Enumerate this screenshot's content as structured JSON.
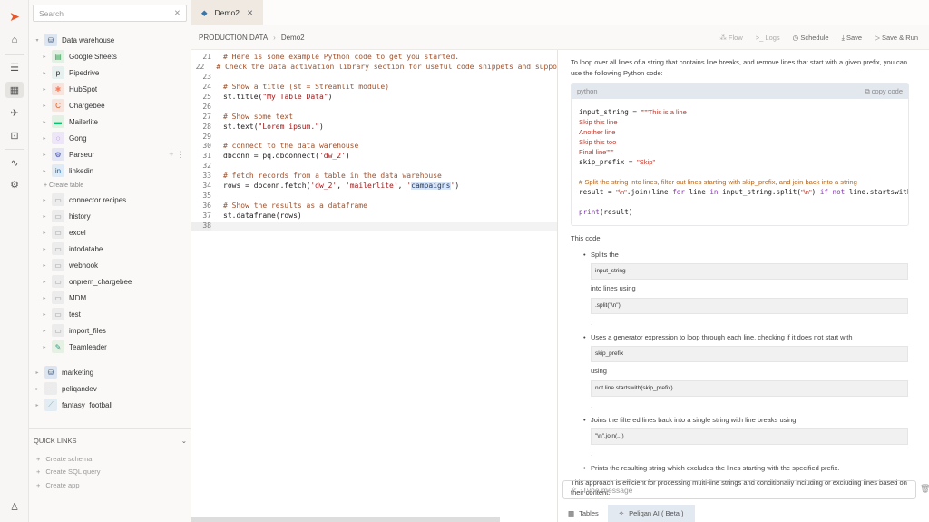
{
  "rail": {
    "icons": [
      "logo-icon",
      "home-icon",
      "stack-icon",
      "table-icon",
      "rocket-icon",
      "box-icon",
      "activity-icon",
      "gear-icon",
      "user-icon"
    ],
    "active": "table-icon"
  },
  "sidebar": {
    "search_placeholder": "Search",
    "root": {
      "label": "Data warehouse",
      "expanded": true
    },
    "items": [
      {
        "label": "Google Sheets",
        "icon": "google-sheets-icon",
        "bg": "#e3f1e5",
        "fg": "#34a853",
        "glyph": "▤"
      },
      {
        "label": "Pipedrive",
        "icon": "pipedrive-icon",
        "bg": "#e6f0ee",
        "fg": "#1a1a1a",
        "glyph": "p"
      },
      {
        "label": "HubSpot",
        "icon": "hubspot-icon",
        "bg": "#f6e5df",
        "fg": "#ff7a59",
        "glyph": "✱"
      },
      {
        "label": "Chargebee",
        "icon": "chargebee-icon",
        "bg": "#f6e5df",
        "fg": "#e0591f",
        "glyph": "C"
      },
      {
        "label": "Mailerlite",
        "icon": "mailerlite-icon",
        "bg": "#e3f1e5",
        "fg": "#09c269",
        "glyph": "▬"
      },
      {
        "label": "Gong",
        "icon": "gong-icon",
        "bg": "#ece6f6",
        "fg": "#8039df",
        "glyph": "◌"
      },
      {
        "label": "Parseur",
        "icon": "parseur-icon",
        "bg": "#e4e6f3",
        "fg": "#3b4cae",
        "glyph": "⚙"
      },
      {
        "label": "linkedin",
        "icon": "linkedin-icon",
        "bg": "#e1ebf5",
        "fg": "#0a66c2",
        "glyph": "in"
      }
    ],
    "create_table": "+ Create table",
    "folders": [
      "connector recipes",
      "history",
      "excel",
      "intodatabe",
      "webhook",
      "onprem_chargebee",
      "MDM",
      "test",
      "import_files"
    ],
    "teamleader": "Teamleader",
    "roots": [
      {
        "label": "marketing",
        "icon": "database-icon"
      },
      {
        "label": "peliqandev",
        "icon": "server-icon"
      },
      {
        "label": "fantasy_football",
        "icon": "chart-icon"
      }
    ],
    "quick_links": {
      "title": "QUICK LINKS",
      "items": [
        "Create schema",
        "Create SQL query",
        "Create app"
      ]
    }
  },
  "tab": {
    "label": "Demo2"
  },
  "breadcrumb": [
    "PRODUCTION DATA",
    "Demo2"
  ],
  "toolbar": {
    "flow": "Flow",
    "logs": "Logs",
    "schedule": "Schedule",
    "save": "Save",
    "save_run": "Save & Run"
  },
  "editor": {
    "lines": [
      {
        "n": "21",
        "seg": [
          [
            "c",
            "# Here is some example Python code to get you started."
          ]
        ]
      },
      {
        "n": "22",
        "seg": [
          [
            "c",
            "# Check the Data activation library section for useful code snippets and suppo"
          ]
        ]
      },
      {
        "n": "23",
        "seg": []
      },
      {
        "n": "24",
        "seg": [
          [
            "c",
            "# Show a title (st = Streamlit module)"
          ]
        ]
      },
      {
        "n": "25",
        "seg": [
          [
            "p",
            "st.title("
          ],
          [
            "s",
            "\"My Table Data\""
          ],
          [
            "p",
            ")"
          ]
        ]
      },
      {
        "n": "26",
        "seg": []
      },
      {
        "n": "27",
        "seg": [
          [
            "c",
            "# Show some text"
          ]
        ]
      },
      {
        "n": "28",
        "seg": [
          [
            "p",
            "st.text("
          ],
          [
            "s",
            "\"Lorem ipsum.\""
          ],
          [
            "p",
            ")"
          ]
        ]
      },
      {
        "n": "29",
        "seg": []
      },
      {
        "n": "30",
        "seg": [
          [
            "c",
            "# connect to the data warehouse"
          ]
        ]
      },
      {
        "n": "31",
        "seg": [
          [
            "p",
            "dbconn = pq.dbconnect("
          ],
          [
            "s",
            "'dw_2'"
          ],
          [
            "p",
            ")"
          ]
        ]
      },
      {
        "n": "32",
        "seg": []
      },
      {
        "n": "33",
        "seg": [
          [
            "c",
            "# fetch records from a table in the data warehouse"
          ]
        ]
      },
      {
        "n": "34",
        "seg": [
          [
            "p",
            "rows = dbconn.fetch("
          ],
          [
            "s",
            "'dw_2'"
          ],
          [
            "p",
            ", "
          ],
          [
            "s",
            "'mailerlite'"
          ],
          [
            "p",
            ", "
          ],
          [
            "s",
            "'"
          ],
          [
            "h",
            "campaigns"
          ],
          [
            "s",
            "'"
          ],
          [
            "p",
            ")"
          ]
        ]
      },
      {
        "n": "35",
        "seg": []
      },
      {
        "n": "36",
        "seg": [
          [
            "c",
            "# Show the results as a dataframe"
          ]
        ]
      },
      {
        "n": "37",
        "seg": [
          [
            "p",
            "st.dataframe(rows)"
          ]
        ]
      },
      {
        "n": "38",
        "seg": [],
        "current": true
      }
    ]
  },
  "ai": {
    "intro": "To loop over all lines of a string that contains line breaks, and remove lines that start with a given prefix, you can use the following Python code:",
    "code_lang": "python",
    "copy": "copy code",
    "code": {
      "l1a": "input_string = ",
      "l1b": "\"\"\"This is a line",
      "l2": "Skip this line",
      "l3": "Another line",
      "l4": "Skip this too",
      "l5": "Final line\"\"\"",
      "l6a": "skip_prefix = ",
      "l6b": "\"Skip\"",
      "comment": "# Split the string into lines, filter out lines starting with skip_prefix, and join back into a string",
      "r1": "result = ",
      "r2": "\"\\n\"",
      "r3": ".join(line ",
      "r4": "for",
      "r5": " line ",
      "r6": "in",
      "r7": " input_string.split(",
      "r8": "\"\\n\"",
      "r9": ") ",
      "r10": "if not",
      "r11": " line.startswith",
      "p1": "print",
      "p2": "(result)"
    },
    "this_code": "This code:",
    "b1": "Splits the",
    "b1c1": "input_string",
    "b1t": "into lines using",
    "b1c2": ".split(\"\\n\")",
    "b2": "Uses a generator expression to loop through each line, checking if it does not start with",
    "b2c1": "skip_prefix",
    "b2t": "using",
    "b2c2": "not line.startswith(skip_prefix)",
    "b3": "Joins the filtered lines back into a single string with line breaks using",
    "b3c1": "\"\\n\".join(...)",
    "b4": "Prints the resulting string which excludes the lines starting with the specified prefix.",
    "outro": "This approach is efficient for processing multi-line strings and conditionally including or excluding lines based on their content.",
    "message_placeholder": "Type message"
  },
  "bottom_tabs": {
    "tables": "Tables",
    "ai": "Peliqan AI ( Beta )"
  }
}
